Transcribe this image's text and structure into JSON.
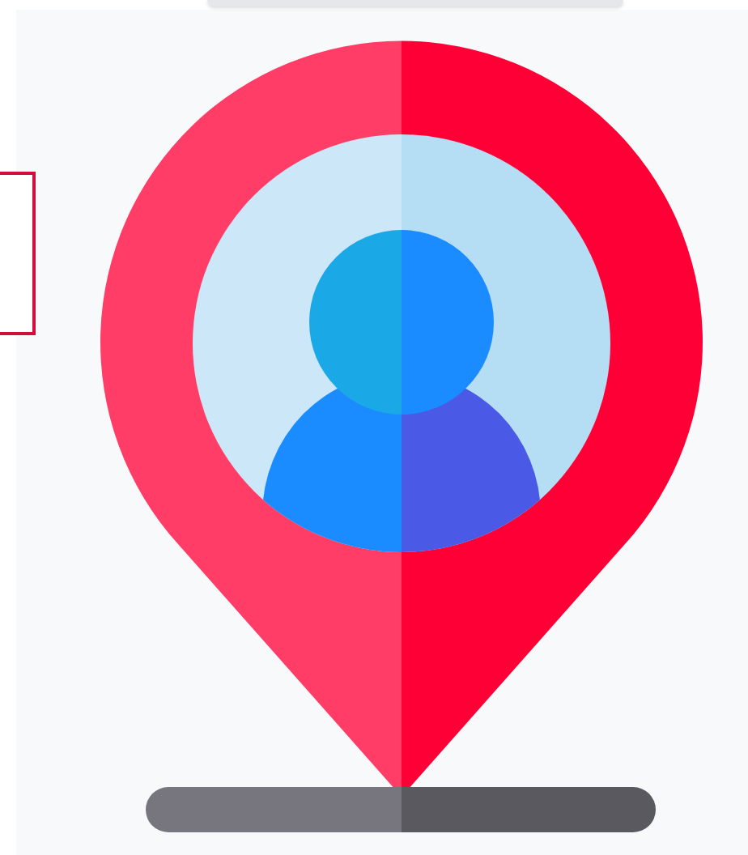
{
  "illustration": {
    "kind": "location-pin-person"
  }
}
